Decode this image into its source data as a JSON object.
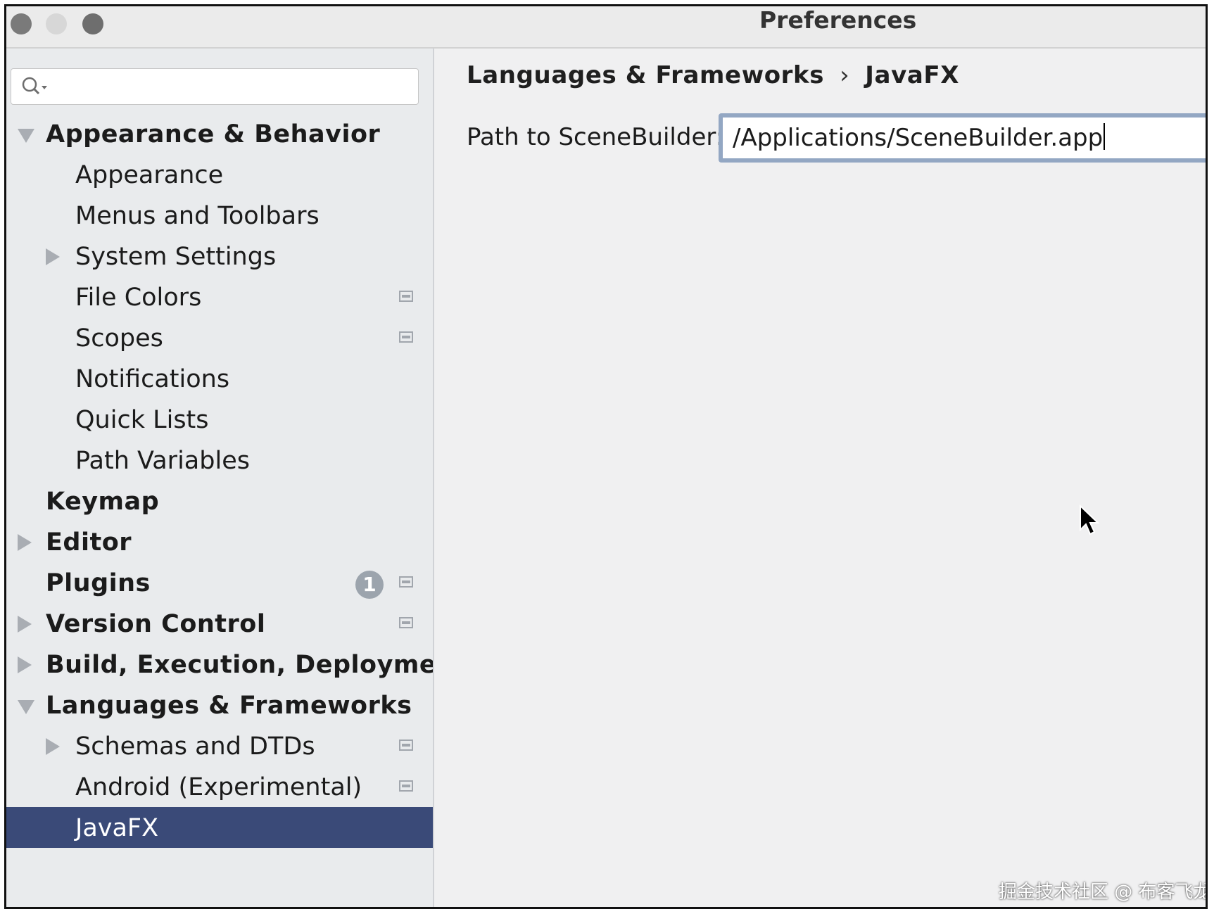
{
  "window": {
    "title": "Preferences",
    "traffic_lights": [
      "close",
      "minimize",
      "maximize"
    ]
  },
  "sidebar": {
    "search": {
      "value": "",
      "icon": "search-icon"
    },
    "items": [
      {
        "label": "Appearance & Behavior",
        "level": 0,
        "expander": "expanded",
        "project_icon": false
      },
      {
        "label": "Appearance",
        "level": 1,
        "expander": "none",
        "project_icon": false
      },
      {
        "label": "Menus and Toolbars",
        "level": 1,
        "expander": "none",
        "project_icon": false
      },
      {
        "label": "System Settings",
        "level": 1,
        "expander": "collapsed",
        "project_icon": false
      },
      {
        "label": "File Colors",
        "level": 1,
        "expander": "none",
        "project_icon": true
      },
      {
        "label": "Scopes",
        "level": 1,
        "expander": "none",
        "project_icon": true
      },
      {
        "label": "Notifications",
        "level": 1,
        "expander": "none",
        "project_icon": false
      },
      {
        "label": "Quick Lists",
        "level": 1,
        "expander": "none",
        "project_icon": false
      },
      {
        "label": "Path Variables",
        "level": 1,
        "expander": "none",
        "project_icon": false
      },
      {
        "label": "Keymap",
        "level": 0,
        "expander": "none",
        "project_icon": false
      },
      {
        "label": "Editor",
        "level": 0,
        "expander": "collapsed",
        "project_icon": false
      },
      {
        "label": "Plugins",
        "level": 0,
        "expander": "none",
        "project_icon": true,
        "badge": "1"
      },
      {
        "label": "Version Control",
        "level": 0,
        "expander": "collapsed",
        "project_icon": true
      },
      {
        "label": "Build, Execution, Deployment",
        "level": 0,
        "expander": "collapsed",
        "project_icon": false
      },
      {
        "label": "Languages & Frameworks",
        "level": 0,
        "expander": "expanded",
        "project_icon": false
      },
      {
        "label": "Schemas and DTDs",
        "level": 1,
        "expander": "collapsed",
        "project_icon": true
      },
      {
        "label": "Android (Experimental)",
        "level": 1,
        "expander": "none",
        "project_icon": true
      },
      {
        "label": "JavaFX",
        "level": 1,
        "expander": "none",
        "project_icon": false,
        "selected": true
      }
    ]
  },
  "content": {
    "breadcrumb": [
      "Languages & Frameworks",
      "JavaFX"
    ],
    "breadcrumb_separator": "›",
    "path_label": "Path to SceneBuilder:",
    "path_value": "/Applications/SceneBuilder.app"
  },
  "watermark": "掘金技术社区 @ 布客飞龙",
  "colors": {
    "selection": "#3a4a78",
    "field_focus": "#93a7c3",
    "badge": "#9ca4ad"
  }
}
